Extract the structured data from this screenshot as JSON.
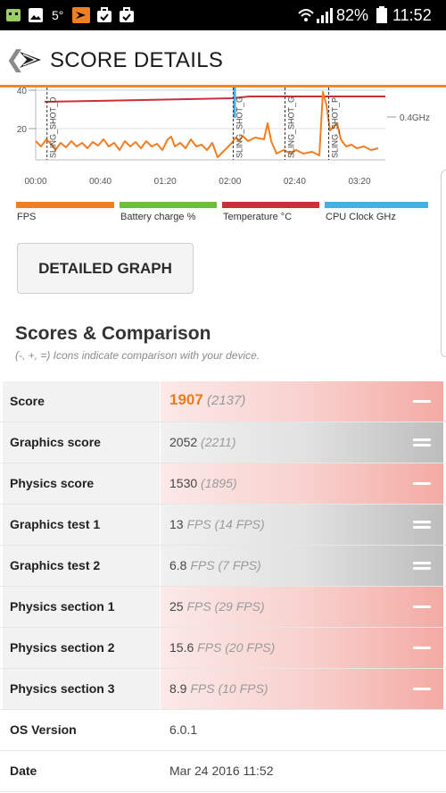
{
  "status_bar": {
    "temperature": "5°",
    "battery_percent": "82%",
    "time": "11:52"
  },
  "app_bar": {
    "back_icon": "chevron-left-icon",
    "logo_icon": "3dmark-logo-icon",
    "title": "SCORE DETAILS"
  },
  "chart": {
    "y_ticks": [
      "40",
      "20"
    ],
    "x_ticks": [
      "00:00",
      "00:40",
      "01:20",
      "02:00",
      "02:40",
      "03:20"
    ],
    "right_label": "0.4GHz",
    "markers": [
      {
        "label": "SLING_SHOT_D",
        "time": "00:07"
      },
      {
        "label": "SLING_SHOT_G",
        "time": "02:02"
      },
      {
        "label": "SLING_SHOT_G",
        "time": "02:34"
      },
      {
        "label": "SLING_SHOT_P",
        "time": "03:01"
      }
    ]
  },
  "legend": [
    {
      "label": "FPS",
      "color": "#f07f22"
    },
    {
      "label": "Battery charge %",
      "color": "#6cbf3c"
    },
    {
      "label": "Temperature °C",
      "color": "#c9303a"
    },
    {
      "label": "CPU Clock GHz",
      "color": "#46aee2"
    }
  ],
  "detailed_graph_button": "DETAILED GRAPH",
  "section": {
    "title": "Scores & Comparison",
    "subtitle": "(-, +, =) Icons indicate comparison with your device."
  },
  "rows": [
    {
      "label": "Score",
      "value": "1907",
      "unit": "",
      "compare": "(2137)",
      "indicator": "minus",
      "primary": true
    },
    {
      "label": "Graphics score",
      "value": "2052",
      "unit": "",
      "compare": "(2211)",
      "indicator": "equal"
    },
    {
      "label": "Physics score",
      "value": "1530",
      "unit": "",
      "compare": "(1895)",
      "indicator": "minus"
    },
    {
      "label": "Graphics test 1",
      "value": "13",
      "unit": "FPS",
      "compare": "(14 FPS)",
      "indicator": "equal"
    },
    {
      "label": "Graphics test 2",
      "value": "6.8",
      "unit": "FPS",
      "compare": "(7 FPS)",
      "indicator": "equal"
    },
    {
      "label": "Physics section 1",
      "value": "25",
      "unit": "FPS",
      "compare": "(29 FPS)",
      "indicator": "minus"
    },
    {
      "label": "Physics section 2",
      "value": "15.6",
      "unit": "FPS",
      "compare": "(20 FPS)",
      "indicator": "minus"
    },
    {
      "label": "Physics section 3",
      "value": "8.9",
      "unit": "FPS",
      "compare": "(10 FPS)",
      "indicator": "minus"
    },
    {
      "label": "OS Version",
      "value": "6.0.1",
      "unit": "",
      "compare": "",
      "indicator": "none"
    },
    {
      "label": "Date",
      "value": "Mar 24 2016 11:52",
      "unit": "",
      "compare": "",
      "indicator": "none"
    }
  ]
}
